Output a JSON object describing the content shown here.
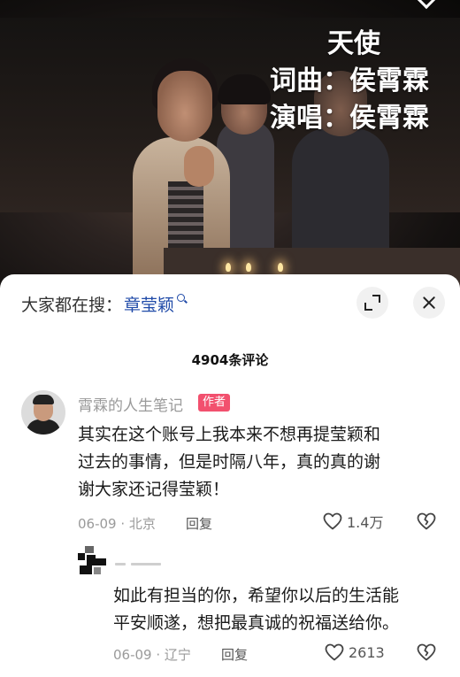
{
  "video": {
    "song_title": "天使",
    "credit_lyrics_music": "词曲：侯霄霖",
    "credit_singer": "演唱：侯霄霖"
  },
  "sheet": {
    "search_label": "大家都在搜：",
    "search_term": "章莹颖",
    "comment_count": "4904条评论"
  },
  "comments": [
    {
      "author": "霄霖的人生笔记",
      "badge": "作者",
      "text_lines": [
        "其实在这个账号上我本来不想再提莹颖和",
        "过去的事情，但是时隔八年，真的真的谢",
        "谢大家还记得莹颖！"
      ],
      "meta": "06-09 · 北京",
      "reply_label": "回复",
      "likes": "1.4万"
    },
    {
      "author": "",
      "text_lines": [
        "如此有担当的你，希望你以后的生活能",
        "平安顺遂，想把最真诚的祝福送给你。"
      ],
      "meta": "06-09 · 辽宁",
      "reply_label": "回复",
      "likes": "2613"
    }
  ],
  "icons": {
    "collapse": "collapse-icon",
    "close": "close-icon",
    "like": "heart-icon",
    "dislike": "broken-heart-icon",
    "search_hint": "search-icon"
  },
  "colors": {
    "accent_link": "#1f4aa8",
    "badge": "#f2506e",
    "muted_text": "#9a9a9a"
  }
}
